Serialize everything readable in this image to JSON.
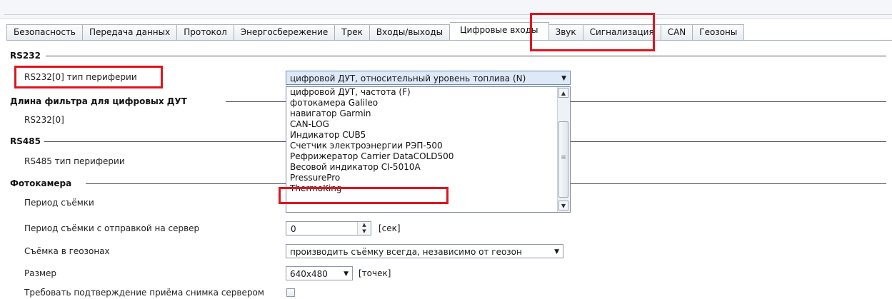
{
  "tabs": [
    {
      "label": "Безопасность"
    },
    {
      "label": "Передача данных"
    },
    {
      "label": "Протокол"
    },
    {
      "label": "Энергосбережение"
    },
    {
      "label": "Трек"
    },
    {
      "label": "Входы/выходы"
    },
    {
      "label": "Цифровые входы",
      "active": true
    },
    {
      "label": "Звук"
    },
    {
      "label": "Сигнализация"
    },
    {
      "label": "CAN"
    },
    {
      "label": "Геозоны"
    }
  ],
  "sections": {
    "rs232": "RS232",
    "fuel_filter": "Длина фильтра для цифровых ДУТ",
    "rs485": "RS485",
    "camera": "Фотокамера"
  },
  "rs232": {
    "periph_label": "RS232[0] тип периферии",
    "periph_value": "цифровой ДУТ, относительный уровень топлива (N)",
    "options": [
      "цифровой ДУТ, частота (F)",
      "фотокамера Galileo",
      "навигатор Garmin",
      "CAN-LOG",
      "Индикатор CUB5",
      "Счетчик электроэнергии РЭП-500",
      "Рефрижератор Carrier DataCOLD500",
      "Весовой индикатор CI-5010A",
      "PressurePro",
      "ThermoKing"
    ]
  },
  "fuel_filter": {
    "rs232_0_label": "RS232[0]"
  },
  "rs485": {
    "periph_label": "RS485 тип периферии"
  },
  "camera": {
    "period_label": "Период съёмки",
    "period_server_label": "Период съёмки с отправкой на сервер",
    "period_server_value": "0",
    "period_server_unit": "[сек]",
    "geozone_label": "Съёмка в геозонах",
    "geozone_value": "производить съёмку всегда, независимо от геозон",
    "size_label": "Размер",
    "size_value": "640x480",
    "size_unit": "[точек]",
    "confirm_label": "Требовать подтверждение приёма снимка сервером",
    "confirm_checked": false
  },
  "colors": {
    "highlight": "#e0141e",
    "accent": "#6a8bb6"
  }
}
